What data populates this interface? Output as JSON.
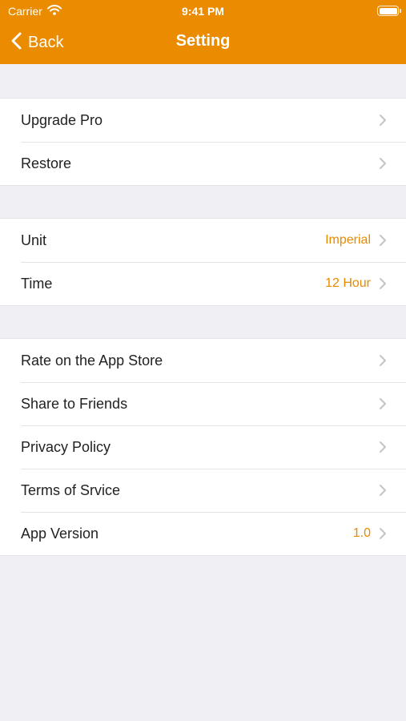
{
  "status_bar": {
    "carrier": "Carrier",
    "time": "9:41 PM"
  },
  "nav": {
    "back_label": "Back",
    "title": "Setting"
  },
  "sections": [
    {
      "rows": [
        {
          "label": "Upgrade Pro",
          "value": ""
        },
        {
          "label": "Restore",
          "value": ""
        }
      ]
    },
    {
      "rows": [
        {
          "label": "Unit",
          "value": "Imperial"
        },
        {
          "label": "Time",
          "value": "12 Hour"
        }
      ]
    },
    {
      "rows": [
        {
          "label": "Rate on the App Store",
          "value": ""
        },
        {
          "label": "Share to Friends",
          "value": ""
        },
        {
          "label": "Privacy Policy",
          "value": ""
        },
        {
          "label": "Terms of Srvice",
          "value": ""
        },
        {
          "label": "App Version",
          "value": "1.0"
        }
      ]
    }
  ],
  "colors": {
    "accent": "#ea8b00",
    "value_text": "#e88a00",
    "background": "#efeff4",
    "chevron": "#c4c4c9"
  },
  "icons": {
    "status_wifi": "wifi-icon",
    "status_battery": "battery-icon",
    "back": "chevron-left-icon",
    "row_disclosure": "chevron-right-icon"
  }
}
